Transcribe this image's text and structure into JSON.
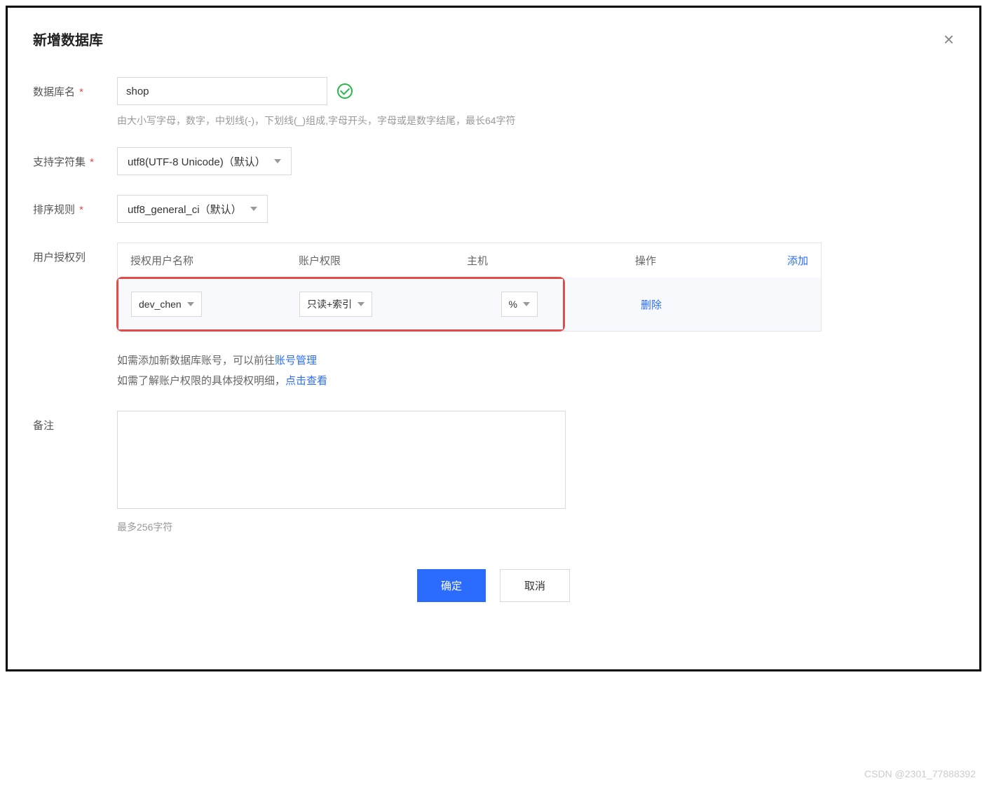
{
  "dialog": {
    "title": "新增数据库",
    "close_icon": "×"
  },
  "fields": {
    "db_name": {
      "label": "数据库名",
      "value": "shop",
      "hint": "由大小写字母，数字，中划线(-)，下划线(_)组成,字母开头，字母或是数字结尾，最长64字符"
    },
    "charset": {
      "label": "支持字符集",
      "value": "utf8(UTF-8 Unicode)（默认）"
    },
    "collation": {
      "label": "排序规则",
      "value": "utf8_general_ci（默认）"
    },
    "auth": {
      "label": "用户授权列",
      "headers": {
        "user": "授权用户名称",
        "perm": "账户权限",
        "host": "主机",
        "op": "操作",
        "add": "添加"
      },
      "rows": [
        {
          "user": "dev_chen",
          "perm": "只读+索引",
          "host": "%",
          "delete": "删除"
        }
      ],
      "info_prefix1": "如需添加新数据库账号，可以前往",
      "info_link1": "账号管理",
      "info_prefix2": "如需了解账户权限的具体授权明细，",
      "info_link2": "点击查看"
    },
    "remark": {
      "label": "备注",
      "hint": "最多256字符"
    }
  },
  "footer": {
    "ok": "确定",
    "cancel": "取消"
  },
  "watermark": "CSDN @2301_77888392"
}
